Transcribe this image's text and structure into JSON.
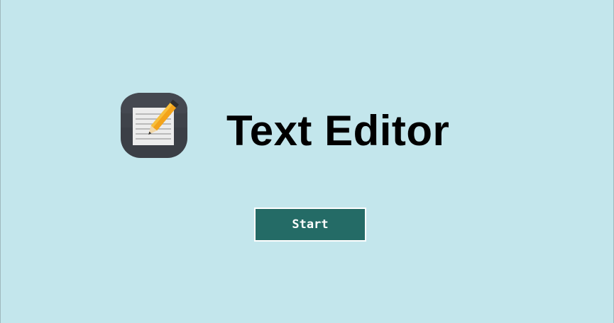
{
  "app": {
    "title": "Text Editor",
    "icon": "notepad-pencil-icon"
  },
  "actions": {
    "start_label": "Start"
  },
  "colors": {
    "background": "#c3e6ec",
    "button_background": "#246b66",
    "button_text": "#ffffff",
    "title_text": "#000000"
  }
}
